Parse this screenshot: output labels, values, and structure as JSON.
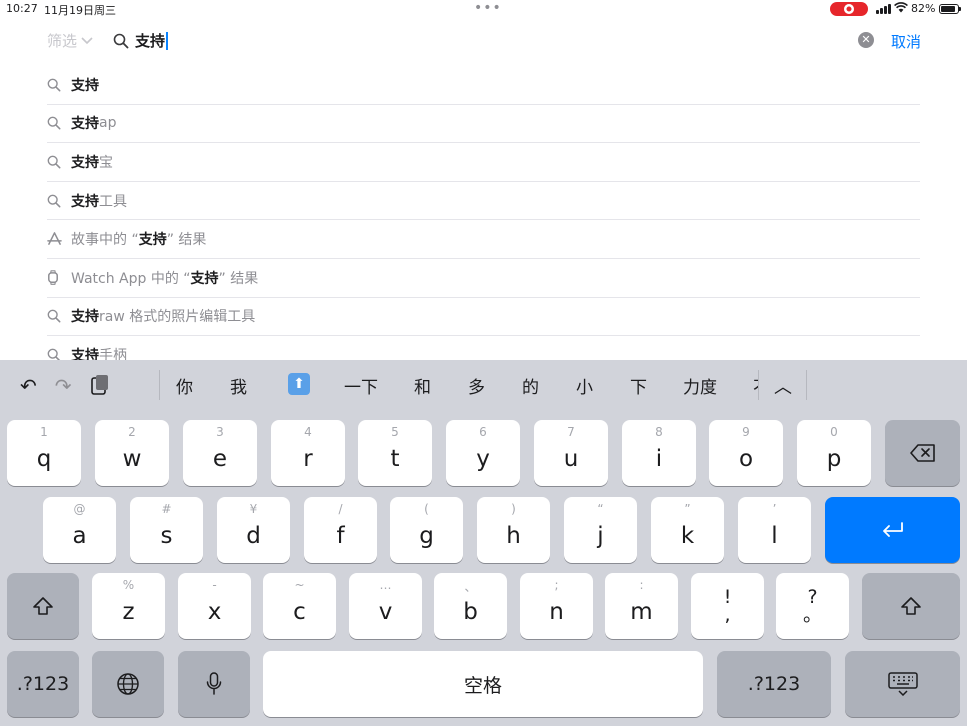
{
  "status": {
    "time": "10:27",
    "date": "11月19日周三",
    "battery": "82%",
    "battery_level": 0.82,
    "dots_icon": "more-dots-icon",
    "recording_icon": "screen-recording-icon"
  },
  "search": {
    "filter_label": "筛选",
    "query": "支持",
    "cancel_label": "取消"
  },
  "suggestions": [
    {
      "icon": "search-icon",
      "prefix": "",
      "bold": "支持",
      "suffix": ""
    },
    {
      "icon": "search-icon",
      "prefix": "",
      "bold": "支持",
      "suffix": " ap"
    },
    {
      "icon": "search-icon",
      "prefix": "",
      "bold": "支持",
      "suffix": "宝"
    },
    {
      "icon": "search-icon",
      "prefix": "",
      "bold": "支持",
      "suffix": "工具"
    },
    {
      "icon": "app-store-icon",
      "prefix": "故事中的 “",
      "bold": "支持",
      "suffix": "” 结果"
    },
    {
      "icon": "watch-icon",
      "prefix": "Watch App 中的 “",
      "bold": "支持",
      "suffix": "” 结果"
    },
    {
      "icon": "search-icon",
      "prefix": "",
      "bold": "支持",
      "suffix": " raw 格式的照片编辑工具"
    },
    {
      "icon": "search-icon",
      "prefix": "",
      "bold": "支持",
      "suffix": "手柄"
    }
  ],
  "keyboard": {
    "candidates": [
      "你",
      "我",
      "⬆️",
      "一下",
      "和",
      "多",
      "的",
      "小",
      "下",
      "力度",
      "不"
    ],
    "row1": [
      {
        "hint": "1",
        "key": "q"
      },
      {
        "hint": "2",
        "key": "w"
      },
      {
        "hint": "3",
        "key": "e"
      },
      {
        "hint": "4",
        "key": "r"
      },
      {
        "hint": "5",
        "key": "t"
      },
      {
        "hint": "6",
        "key": "y"
      },
      {
        "hint": "7",
        "key": "u"
      },
      {
        "hint": "8",
        "key": "i"
      },
      {
        "hint": "9",
        "key": "o"
      },
      {
        "hint": "0",
        "key": "p"
      }
    ],
    "row2": [
      {
        "hint": "@",
        "key": "a"
      },
      {
        "hint": "#",
        "key": "s"
      },
      {
        "hint": "¥",
        "key": "d"
      },
      {
        "hint": "/",
        "key": "f"
      },
      {
        "hint": "(",
        "key": "g"
      },
      {
        "hint": ")",
        "key": "h"
      },
      {
        "hint": "“",
        "key": "j"
      },
      {
        "hint": "”",
        "key": "k"
      },
      {
        "hint": "’",
        "key": "l"
      }
    ],
    "row3": [
      {
        "hint": "%",
        "key": "z"
      },
      {
        "hint": "-",
        "key": "x"
      },
      {
        "hint": "~",
        "key": "c"
      },
      {
        "hint": "…",
        "key": "v"
      },
      {
        "hint": "、",
        "key": "b"
      },
      {
        "hint": ";",
        "key": "n"
      },
      {
        "hint": ":",
        "key": "m"
      }
    ],
    "punct1": {
      "top": "!",
      "bottom": ","
    },
    "punct2": {
      "top": "?",
      "bottom": "。"
    },
    "numbers_label": ".?123",
    "space_label": "空格",
    "colors": {
      "return": "#007aff",
      "background": "#d1d3da",
      "dark_key": "#adb1ba"
    }
  }
}
